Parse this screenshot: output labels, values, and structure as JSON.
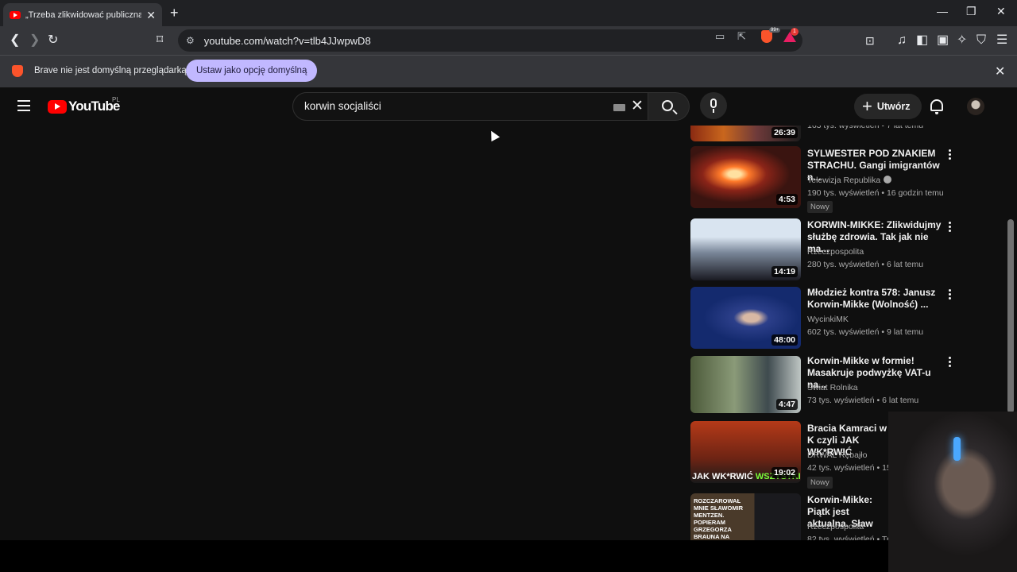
{
  "browser": {
    "tab_title": "„Trzeba zlikwidować publiczną s",
    "new_tab_label": "+",
    "url": "youtube.com/watch?v=tlb4JJwpwD8",
    "shields_count": "99+",
    "rewards_count": "1"
  },
  "infobar": {
    "message": "Brave nie jest domyślną przeglądarką",
    "button_label": "Ustaw jako opcję domyślną"
  },
  "youtube": {
    "logo_text": "YouTube",
    "region": "PL",
    "search_value": "korwin socjaliści",
    "create_label": "Utwórz"
  },
  "partial_top": {
    "duration": "26:39",
    "meta": "163 tys. wyświetleń • 7 lat temu"
  },
  "videos": [
    {
      "title": "SYLWESTER POD ZNAKIEM STRACHU. Gangi imigrantów n...",
      "channel": "Telewizja Republika",
      "meta": "190 tys. wyświetleń • 16 godzin temu",
      "badge": "Nowy",
      "duration": "4:53"
    },
    {
      "title": "KORWIN-MIKKE: Zlikwidujmy służbę zdrowia. Tak jak nie ma...",
      "channel": "Rzeczpospolita",
      "meta": "280 tys. wyświetleń • 6 lat temu",
      "duration": "14:19"
    },
    {
      "title": "Młodzież kontra 578: Janusz Korwin-Mikke (Wolność) ...",
      "channel": "WycinkiMK",
      "meta": "602 tys. wyświetleń • 9 lat temu",
      "duration": "48:00"
    },
    {
      "title": "Korwin-Mikke w formie! Masakruje podwyżkę VAT-u na...",
      "channel": "Świat Rolnika",
      "meta": "73 tys. wyświetleń • 6 lat temu",
      "duration": "4:47"
    },
    {
      "title": "Bracia Kamraci w K czyli JAK WK*RWIĆ",
      "channel": "DRWAL Rębajło",
      "meta": "42 tys. wyświetleń • 15",
      "badge": "Nowy",
      "duration": "19:02",
      "thumb_text_a": "JAK WK*RWIĆ ",
      "thumb_text_b": "WSZYSTKICH"
    },
    {
      "title": "Korwin-Mikke: Piątk jest aktualna. Sław",
      "channel": "Rzeczpospolita",
      "meta": "82 tys. wyświetleń • Tr",
      "thumb_caption": "ROZCZAROWAŁ MNIE SŁAWOMIR MENTZEN. POPIERAM GRZEGORZA BRAUNA NA PREZYDENTA"
    }
  ],
  "colors": {
    "youtube_red": "#ff0000",
    "brave_orange": "#fb542b",
    "infobar_button": "#c1b8ff",
    "page_bg": "#0f0f0f"
  }
}
